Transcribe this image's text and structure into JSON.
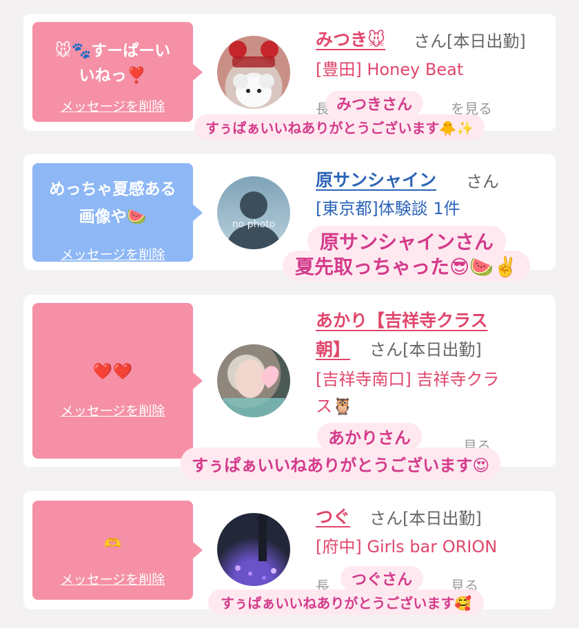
{
  "cards": [
    {
      "bubble_message": "🐭🐾すーぱーいいねっ❣️",
      "bubble_line1": "🐭🐾すーぱーい",
      "bubble_line2": "いねっ❣️",
      "delete_label": "メッセージを削除",
      "name": "みつき🐭",
      "honorific": "さん[本日出勤]",
      "shop": "[豊田] Honey Beat",
      "sticker_name": "みつきさん",
      "sticker_text": "すぅぱぁいいねありがとうございます🐥✨",
      "faded_text": "長",
      "faded_text2": "を見る"
    },
    {
      "bubble_line1": "めっちゃ夏感ある",
      "bubble_line2": "画像や🍉",
      "delete_label": "メッセージを削除",
      "name": "原サンシャイン",
      "honorific": "さん",
      "shop": "[東京都]体験談 1件",
      "avatar_text": "no photo",
      "sticker_line1": "原サンシャインさん",
      "sticker_line2": "夏先取っちゃった😎🍉✌️"
    },
    {
      "bubble_line1": "❤️❤️",
      "delete_label": "メッセージを削除",
      "name_line1": "あかり【吉祥寺クラス",
      "name_line2": "朝】",
      "honorific": "さん[本日出勤]",
      "shop_line1": "[吉祥寺南口] 吉祥寺クラ",
      "shop_line2": "ス🦉",
      "sticker_name": "あかりさん",
      "sticker_text": "すぅぱぁいいねありがとうございます😍",
      "faded_text2": "見る"
    },
    {
      "bubble_line1": "🫶",
      "delete_label": "メッセージを削除",
      "name": "つぐ",
      "honorific": "さん[本日出勤]",
      "shop": "[府中] Girls bar ORION",
      "sticker_name": "つぐさん",
      "sticker_text": "すぅぱぁいいねありがとうございます🥰",
      "faded_text": "長",
      "faded_text2": "見る"
    }
  ]
}
